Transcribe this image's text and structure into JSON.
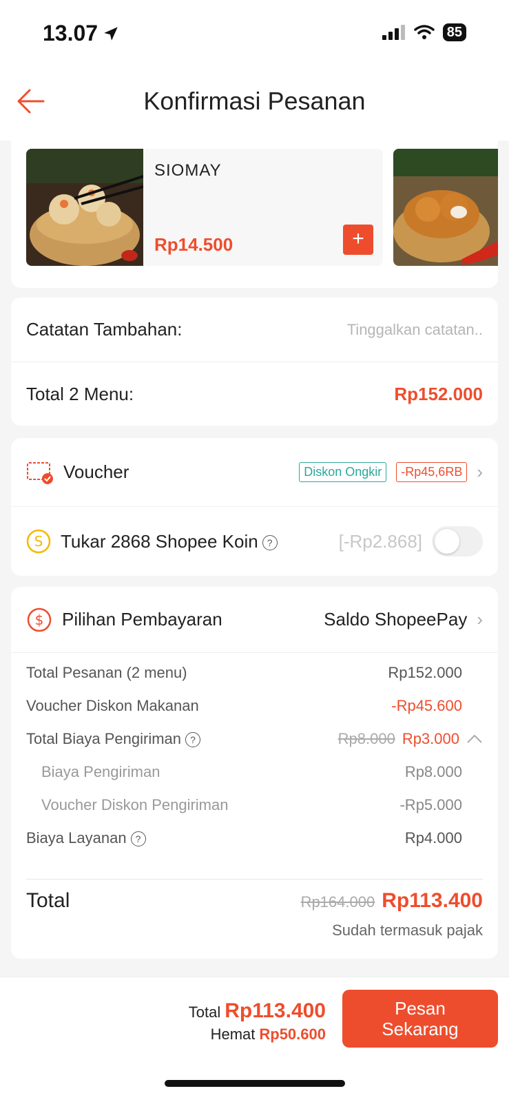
{
  "status_bar": {
    "time": "13.07",
    "battery": "85"
  },
  "header": {
    "title": "Konfirmasi Pesanan"
  },
  "menu": {
    "items": [
      {
        "name": "SIOMAY",
        "price": "Rp14.500",
        "add": "+"
      }
    ]
  },
  "notes": {
    "label": "Catatan Tambahan:",
    "placeholder": "Tinggalkan catatan.."
  },
  "total_menu": {
    "label": "Total 2 Menu:",
    "value": "Rp152.000"
  },
  "voucher": {
    "label": "Voucher",
    "tag_shipping": "Diskon Ongkir",
    "tag_discount": "-Rp45,6RB"
  },
  "coins": {
    "label": "Tukar 2868 Shopee Koin",
    "amount": "[-Rp2.868]"
  },
  "payment": {
    "label": "Pilihan Pembayaran",
    "method": "Saldo ShopeePay"
  },
  "summary": {
    "order_total_label": "Total Pesanan (2 menu)",
    "order_total": "Rp152.000",
    "food_voucher_label": "Voucher Diskon Makanan",
    "food_voucher": "-Rp45.600",
    "delivery_total_label": "Total Biaya Pengiriman",
    "delivery_old": "Rp8.000",
    "delivery_new": "Rp3.000",
    "delivery_fee_label": "Biaya Pengiriman",
    "delivery_fee": "Rp8.000",
    "delivery_voucher_label": "Voucher Diskon Pengiriman",
    "delivery_voucher": "-Rp5.000",
    "service_fee_label": "Biaya Layanan",
    "service_fee": "Rp4.000",
    "total_label": "Total",
    "total_old": "Rp164.000",
    "total_new": "Rp113.400",
    "tax_note": "Sudah termasuk pajak"
  },
  "footer": {
    "total_label": "Total",
    "total": "Rp113.400",
    "save_label": "Hemat",
    "save": "Rp50.600",
    "button_line1": "Pesan",
    "button_line2": "Sekarang"
  },
  "colors": {
    "accent": "#ee4d2d",
    "voucher_green": "#26aa99",
    "coin_yellow": "#f5b800"
  }
}
